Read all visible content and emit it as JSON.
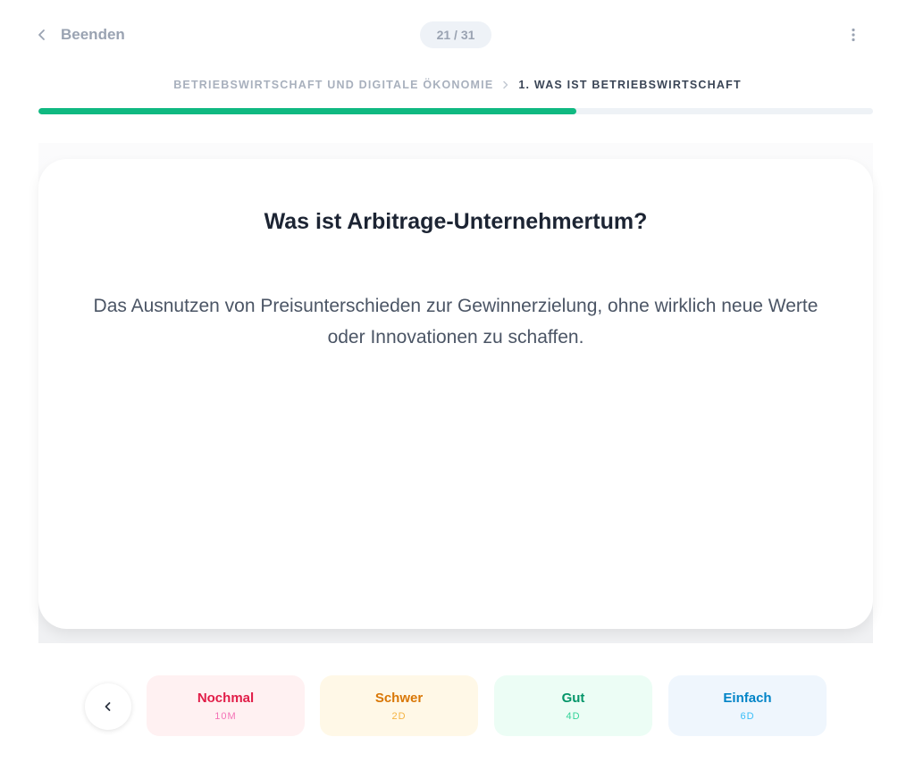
{
  "header": {
    "back_label": "Beenden",
    "counter": "21 / 31",
    "current_card": 21,
    "total_cards": 31,
    "menu_icon": "more-vertical-icon"
  },
  "breadcrumb": {
    "parent": "BETRIEBSWIRTSCHAFT UND DIGITALE ÖKONOMIE",
    "separator_icon": "chevron-right-icon",
    "current": "1. WAS IST BETRIEBSWIRTSCHAFT"
  },
  "progress": {
    "fraction": 0.645,
    "color": "#10b981"
  },
  "card": {
    "question": "Was ist Arbitrage-Unternehmertum?",
    "answer": "Das Ausnutzen von Preisunterschieden zur Gewinnerzielung, ohne wirklich neue Werte oder Innovationen zu schaffen."
  },
  "controls": {
    "prev_icon": "chevron-left-icon",
    "ratings": [
      {
        "label": "Nochmal",
        "interval": "10M",
        "color": "#e11d48"
      },
      {
        "label": "Schwer",
        "interval": "2D",
        "color": "#d97706"
      },
      {
        "label": "Gut",
        "interval": "4D",
        "color": "#059669"
      },
      {
        "label": "Einfach",
        "interval": "6D",
        "color": "#0284c7"
      }
    ]
  }
}
